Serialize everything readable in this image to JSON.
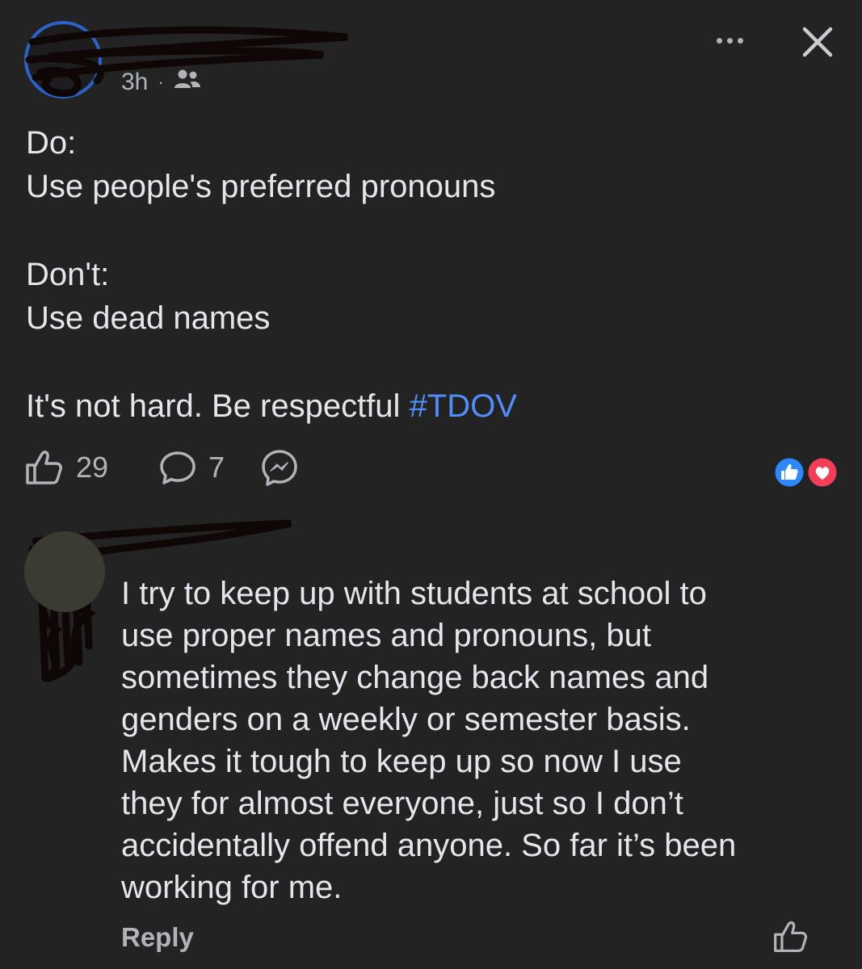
{
  "post": {
    "time": "3h",
    "separator": "·",
    "audience_icon": "friends-icon",
    "body_lines": [
      "Do:",
      "Use people's preferred pronouns",
      "",
      "Don't:",
      "Use dead names",
      "",
      "It's not hard. Be respectful "
    ],
    "hashtag": "#TDOV",
    "like_count": "29",
    "comment_count": "7",
    "reactions": [
      "like",
      "love"
    ]
  },
  "comment": {
    "body_lines": [
      "I try to keep up with students at school to",
      "use proper names and pronouns, but",
      "sometimes they change back names and",
      "genders on a weekly or semester basis.",
      "Makes it tough to keep up so now I use",
      "they for almost everyone, just so I don’t",
      "accidentally offend anyone. So far it’s been",
      "working for me."
    ],
    "reply_label": "Reply"
  },
  "colors": {
    "background": "#232324",
    "text": "#e4e6eb",
    "muted": "#b0b3b8",
    "hashtag": "#4f8ff7",
    "like_blue": "#2d88ff",
    "love_red": "#f33e58"
  }
}
